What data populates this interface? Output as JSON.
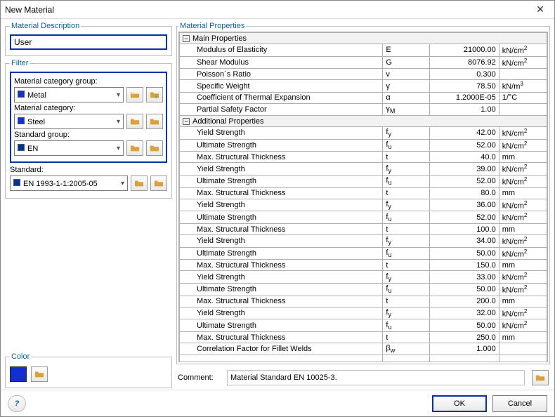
{
  "window": {
    "title": "New Material"
  },
  "description": {
    "legend": "Material Description",
    "value": "User"
  },
  "filter": {
    "legend": "Filter",
    "group_label": "Material category group:",
    "group_value": "Metal",
    "group_color": "#1030d0",
    "category_label": "Material category:",
    "category_value": "Steel",
    "category_color": "#1030d0",
    "stdgroup_label": "Standard group:",
    "stdgroup_value": "EN",
    "standard_label": "Standard:",
    "standard_value": "EN 1993-1-1:2005-05"
  },
  "color": {
    "legend": "Color",
    "hex": "#1030d0"
  },
  "props": {
    "legend": "Material Properties",
    "section1": "Main Properties",
    "section2": "Additional Properties",
    "rows1": [
      {
        "name": "Modulus of Elasticity",
        "sym": "E",
        "val": "21000.00",
        "unit": "kN/cm²"
      },
      {
        "name": "Shear Modulus",
        "sym": "G",
        "val": "8076.92",
        "unit": "kN/cm²"
      },
      {
        "name": "Poisson´s Ratio",
        "sym": "ν",
        "val": "0.300",
        "unit": ""
      },
      {
        "name": "Specific Weight",
        "sym": "γ",
        "val": "78.50",
        "unit": "kN/m³"
      },
      {
        "name": "Coefficient of Thermal Expansion",
        "sym": "α",
        "val": "1.2000E-05",
        "unit": "1/°C"
      },
      {
        "name": "Partial Safety Factor",
        "sym": "γM",
        "val": "1.00",
        "unit": ""
      }
    ],
    "rows2": [
      {
        "name": "Yield Strength",
        "sym": "fy",
        "val": "42.00",
        "unit": "kN/cm²"
      },
      {
        "name": "Ultimate Strength",
        "sym": "fu",
        "val": "52.00",
        "unit": "kN/cm²"
      },
      {
        "name": "Max. Structural Thickness",
        "sym": "t",
        "val": "40.0",
        "unit": "mm"
      },
      {
        "name": "Yield Strength",
        "sym": "fy",
        "val": "39.00",
        "unit": "kN/cm²"
      },
      {
        "name": "Ultimate Strength",
        "sym": "fu",
        "val": "52.00",
        "unit": "kN/cm²"
      },
      {
        "name": "Max. Structural Thickness",
        "sym": "t",
        "val": "80.0",
        "unit": "mm"
      },
      {
        "name": "Yield Strength",
        "sym": "fy",
        "val": "36.00",
        "unit": "kN/cm²"
      },
      {
        "name": "Ultimate Strength",
        "sym": "fu",
        "val": "52.00",
        "unit": "kN/cm²"
      },
      {
        "name": "Max. Structural Thickness",
        "sym": "t",
        "val": "100.0",
        "unit": "mm"
      },
      {
        "name": "Yield Strength",
        "sym": "fy",
        "val": "34.00",
        "unit": "kN/cm²"
      },
      {
        "name": "Ultimate Strength",
        "sym": "fu",
        "val": "50.00",
        "unit": "kN/cm²"
      },
      {
        "name": "Max. Structural Thickness",
        "sym": "t",
        "val": "150.0",
        "unit": "mm"
      },
      {
        "name": "Yield Strength",
        "sym": "fy",
        "val": "33.00",
        "unit": "kN/cm²"
      },
      {
        "name": "Ultimate Strength",
        "sym": "fu",
        "val": "50.00",
        "unit": "kN/cm²"
      },
      {
        "name": "Max. Structural Thickness",
        "sym": "t",
        "val": "200.0",
        "unit": "mm"
      },
      {
        "name": "Yield Strength",
        "sym": "fy",
        "val": "32.00",
        "unit": "kN/cm²"
      },
      {
        "name": "Ultimate Strength",
        "sym": "fu",
        "val": "50.00",
        "unit": "kN/cm²"
      },
      {
        "name": "Max. Structural Thickness",
        "sym": "t",
        "val": "250.0",
        "unit": "mm"
      },
      {
        "name": "Correlation Factor for Fillet Welds",
        "sym": "βw",
        "val": "1.000",
        "unit": ""
      }
    ]
  },
  "comment": {
    "label": "Comment:",
    "value": "Material Standard EN 10025-3."
  },
  "buttons": {
    "ok": "OK",
    "cancel": "Cancel"
  }
}
